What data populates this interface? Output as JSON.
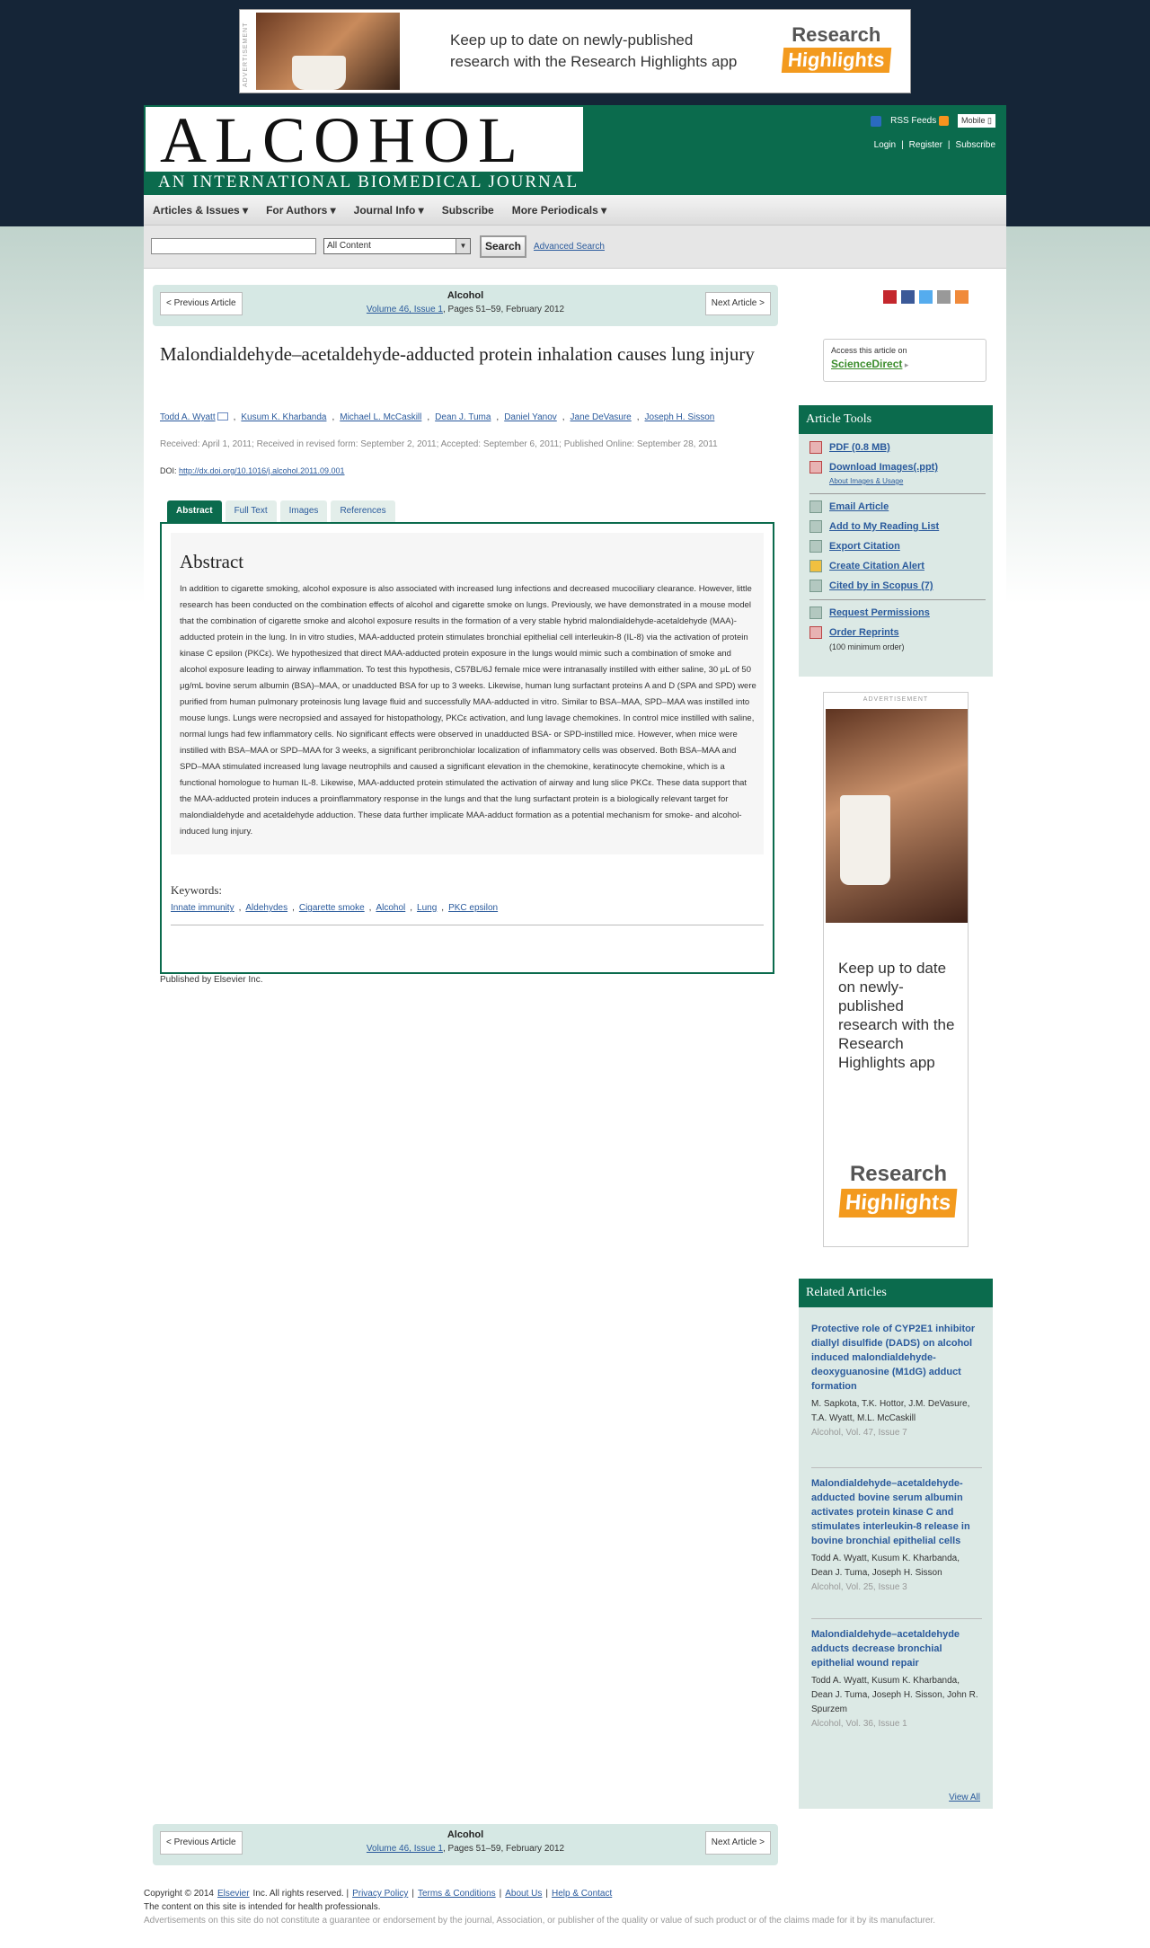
{
  "top_ad": {
    "label": "ADVERTISEMENT",
    "text": "Keep up to date on newly-published research with the Research Highlights app",
    "logo_top": "Research",
    "logo_bottom": "Highlights"
  },
  "header": {
    "journal_title": "ALCOHOL",
    "journal_subtitle": "AN INTERNATIONAL BIOMEDICAL JOURNAL",
    "rss": "RSS Feeds",
    "mobile": "Mobile",
    "login": "Login",
    "register": "Register",
    "subscribe": "Subscribe"
  },
  "nav": {
    "items": [
      "Articles & Issues ▾",
      "For Authors ▾",
      "Journal Info ▾",
      "Subscribe",
      "More Periodicals ▾"
    ]
  },
  "search": {
    "scope": "All Content",
    "button": "Search",
    "advanced": "Advanced Search"
  },
  "article_nav": {
    "prev": "< Previous Article",
    "next": "Next Article >",
    "journal": "Alcohol",
    "volume_link": "Volume 46, Issue 1",
    "pages": ", Pages 51–59, February 2012"
  },
  "article": {
    "title": "Malondialdehyde–acetaldehyde-adducted protein inhalation causes lung injury",
    "authors": [
      "Todd A. Wyatt",
      "Kusum K. Kharbanda",
      "Michael L. McCaskill",
      "Dean J. Tuma",
      "Daniel Yanov",
      "Jane DeVasure",
      "Joseph H. Sisson"
    ],
    "dates": "Received: April 1, 2011; Received in revised form: September 2, 2011; Accepted: September 6, 2011; Published Online: September 28, 2011",
    "doi_label": "DOI:",
    "doi": "http://dx.doi.org/10.1016/j.alcohol.2011.09.001",
    "tabs": [
      "Abstract",
      "Full Text",
      "Images",
      "References"
    ],
    "abstract_heading": "Abstract",
    "abstract": "In addition to cigarette smoking, alcohol exposure is also associated with increased lung infections and decreased mucociliary clearance. However, little research has been conducted on the combination effects of alcohol and cigarette smoke on lungs. Previously, we have demonstrated in a mouse model that the combination of cigarette smoke and alcohol exposure results in the formation of a very stable hybrid malondialdehyde-acetaldehyde (MAA)-adducted protein in the lung. In in vitro studies, MAA-adducted protein stimulates bronchial epithelial cell interleukin-8 (IL-8) via the activation of protein kinase C epsilon (PKCε). We hypothesized that direct MAA-adducted protein exposure in the lungs would mimic such a combination of smoke and alcohol exposure leading to airway inflammation. To test this hypothesis, C57BL/6J female mice were intranasally instilled with either saline, 30 μL of 50 μg/mL bovine serum albumin (BSA)–MAA, or unadducted BSA for up to 3 weeks. Likewise, human lung surfactant proteins A and D (SPA and SPD) were purified from human pulmonary proteinosis lung lavage fluid and successfully MAA-adducted in vitro. Similar to BSA–MAA, SPD–MAA was instilled into mouse lungs. Lungs were necropsied and assayed for histopathology, PKCε activation, and lung lavage chemokines. In control mice instilled with saline, normal lungs had few inflammatory cells. No significant effects were observed in unadducted BSA- or SPD-instilled mice. However, when mice were instilled with BSA–MAA or SPD–MAA for 3 weeks, a significant peribronchiolar localization of inflammatory cells was observed. Both BSA–MAA and SPD–MAA stimulated increased lung lavage neutrophils and caused a significant elevation in the chemokine, keratinocyte chemokine, which is a functional homologue to human IL-8. Likewise, MAA-adducted protein stimulated the activation of airway and lung slice PKCε. These data support that the MAA-adducted protein induces a proinflammatory response in the lungs and that the lung surfactant protein is a biologically relevant target for malondialdehyde and acetaldehyde adduction. These data further implicate MAA-adduct formation as a potential mechanism for smoke- and alcohol-induced lung injury.",
    "keywords_heading": "Keywords:",
    "keywords": [
      "Innate immunity",
      "Aldehydes",
      "Cigarette smoke",
      "Alcohol",
      "Lung",
      "PKC epsilon"
    ],
    "published_by": "Published by Elsevier Inc."
  },
  "access": {
    "label": "Access this article on",
    "link": "ScienceDirect"
  },
  "tools": {
    "heading": "Article Tools",
    "pdf": "PDF (0.8 MB)",
    "download_images": "Download Images(.ppt)",
    "about_images": "About Images & Usage",
    "email": "Email Article",
    "reading_list": "Add to My Reading List",
    "export": "Export Citation",
    "alert": "Create Citation Alert",
    "cited": "Cited by in Scopus (7)",
    "permissions": "Request Permissions",
    "reprints": "Order Reprints",
    "reprints_note": "(100 minimum order)"
  },
  "side_ad": {
    "label": "ADVERTISEMENT",
    "text": "Keep up to date on newly-published research with the Research Highlights app",
    "logo_top": "Research",
    "logo_bottom": "Highlights"
  },
  "related": {
    "heading": "Related Articles",
    "items": [
      {
        "title": "Protective role of CYP2E1 inhibitor diallyl disulfide (DADS) on alcohol induced malondialdehyde-deoxyguanosine (M1dG) adduct formation",
        "authors": "M. Sapkota, T.K. Hottor, J.M. DeVasure, T.A. Wyatt, M.L. McCaskill",
        "journal": "Alcohol, Vol. 47, Issue 7"
      },
      {
        "title": "Malondialdehyde–acetaldehyde-adducted bovine serum albumin activates protein kinase C and stimulates interleukin-8 release in bovine bronchial epithelial cells",
        "authors": "Todd A. Wyatt, Kusum K. Kharbanda, Dean J. Tuma, Joseph H. Sisson",
        "journal": "Alcohol, Vol. 25, Issue 3"
      },
      {
        "title": "Malondialdehyde–acetaldehyde adducts decrease bronchial epithelial wound repair",
        "authors": "Todd A. Wyatt, Kusum K. Kharbanda, Dean J. Tuma, Joseph H. Sisson, John R. Spurzem",
        "journal": "Alcohol, Vol. 36, Issue 1"
      }
    ],
    "view_all": "View All"
  },
  "footer": {
    "copyright": "Copyright © 2014",
    "elsevier": "Elsevier",
    "rights": "Inc. All rights reserved. |",
    "links": [
      "Privacy Policy",
      "Terms & Conditions",
      "About Us",
      "Help & Contact"
    ],
    "health": "The content on this site is intended for health professionals.",
    "disclaimer": "Advertisements on this site do not constitute a guarantee or endorsement by the journal, Association, or publisher of the quality or value of such product or of the claims made for it by its manufacturer."
  }
}
